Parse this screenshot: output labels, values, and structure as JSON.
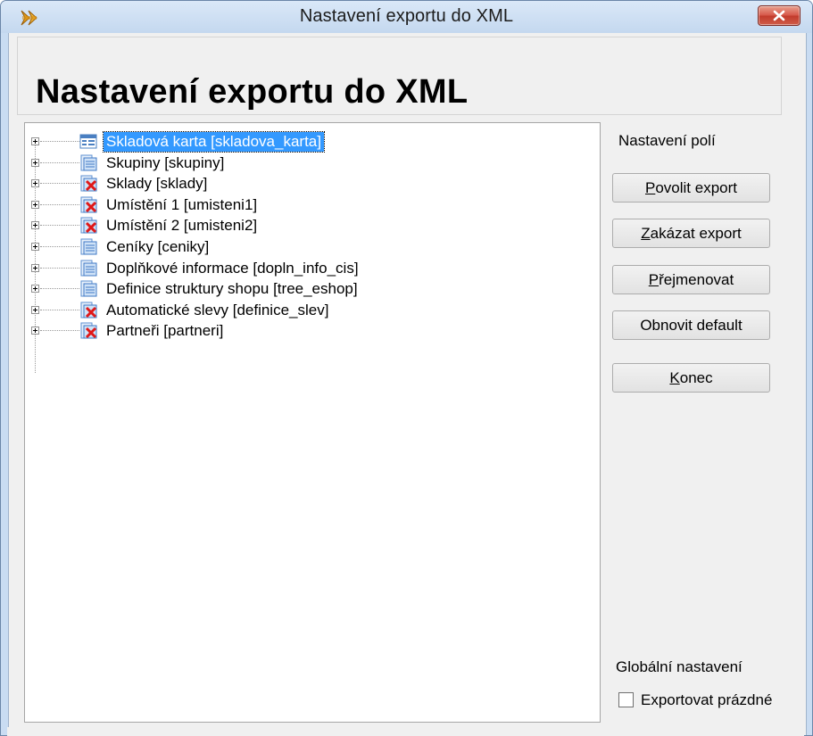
{
  "window": {
    "title": "Nastavení exportu do XML"
  },
  "header": {
    "title": "Nastavení exportu do XML"
  },
  "tree": {
    "items": [
      {
        "label": "Skladová karta [skladova_karta]",
        "icon": "table-form-icon",
        "selected": true
      },
      {
        "label": "Skupiny [skupiny]",
        "icon": "table-enabled-icon",
        "selected": false
      },
      {
        "label": "Sklady [sklady]",
        "icon": "table-disabled-icon",
        "selected": false
      },
      {
        "label": "Umístění 1 [umisteni1]",
        "icon": "table-disabled-icon",
        "selected": false
      },
      {
        "label": "Umístění 2 [umisteni2]",
        "icon": "table-disabled-icon",
        "selected": false
      },
      {
        "label": "Ceníky [ceniky]",
        "icon": "table-enabled-icon",
        "selected": false
      },
      {
        "label": "Doplňkové informace [dopln_info_cis]",
        "icon": "table-enabled-icon",
        "selected": false
      },
      {
        "label": "Definice struktury shopu [tree_eshop]",
        "icon": "table-enabled-icon",
        "selected": false
      },
      {
        "label": "Automatické slevy [definice_slev]",
        "icon": "table-disabled-icon",
        "selected": false
      },
      {
        "label": "Partneři [partneri]",
        "icon": "table-disabled-icon",
        "selected": false
      }
    ]
  },
  "fields_panel": {
    "label": "Nastavení polí",
    "buttons": {
      "enable": {
        "accel": "P",
        "rest": "ovolit export"
      },
      "disable": {
        "accel": "Z",
        "rest": "akázat export"
      },
      "rename": {
        "accel": "P",
        "rest": "řejmenovat"
      },
      "reset_label": "Obnovit default",
      "close": {
        "accel": "K",
        "rest": "onec"
      }
    }
  },
  "global": {
    "label": "Globální nastavení",
    "export_empty_label": "Exportovat prázdné",
    "export_empty_checked": false
  },
  "colors": {
    "selection": "#3399ff",
    "title_bar": "#c9dcf2",
    "close_button": "#c94a3a"
  }
}
